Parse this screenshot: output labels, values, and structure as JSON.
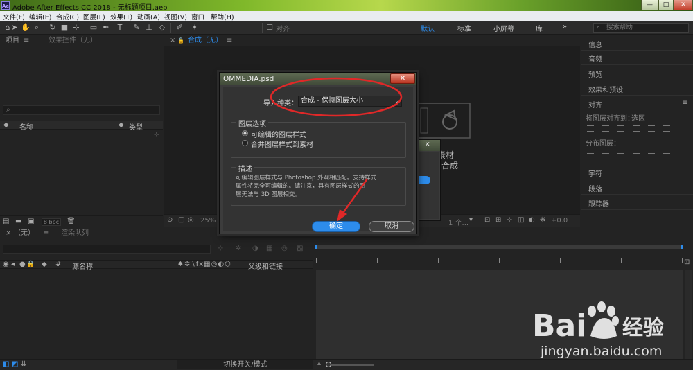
{
  "window": {
    "app_icon": "Ae",
    "title": "Adobe After Effects CC 2018 - 无标题项目.aep",
    "min_label": "—",
    "max_label": "□",
    "close_label": "✕"
  },
  "menu": [
    "文件(F)",
    "编辑(E)",
    "合成(C)",
    "图层(L)",
    "效果(T)",
    "动画(A)",
    "视图(V)",
    "窗口",
    "帮助(H)"
  ],
  "toolbar": {
    "align_label": "对齐",
    "workspaces": [
      "默认",
      "标准",
      "小屏幕",
      "库"
    ],
    "more": "»",
    "search_placeholder": "搜索帮助"
  },
  "project_panel": {
    "tab1": "项目",
    "tab1_menu": "≡",
    "tab2": "效果控件（无）",
    "search_icon": "⌕",
    "col_name": "名称",
    "col_type": "类型",
    "bpc": "8 bpc"
  },
  "comp_panel": {
    "close": "×",
    "lock": "🔒",
    "tab": "合成（无）",
    "tab_menu": "≡",
    "bg_text1": "素材",
    "bg_text2": "合成",
    "zoom": "25%",
    "view_label": "1 个...",
    "offset": "+0.0"
  },
  "right_panel": {
    "items": [
      "信息",
      "音频",
      "预览",
      "效果和预设"
    ],
    "align_title": "对齐",
    "align_title_menu": "≡",
    "align_to_label": "将图层对齐到：",
    "align_to_value": "选区",
    "distribute_label": "分布图层：",
    "items2": [
      "字符",
      "段落",
      "跟踪器"
    ]
  },
  "timeline": {
    "close": "×",
    "tab1": "（无）",
    "tab1_menu": "≡",
    "tab2": "渲染队列",
    "col_hash": "#",
    "col_source": "源名称",
    "col_parent": "父级和链接",
    "footer_label": "切换开关/模式"
  },
  "behind_dialog": {
    "close": "✕"
  },
  "dialog": {
    "title": "OMMEDIA.psd",
    "close": "✕",
    "import_type_label": "导入种类：",
    "import_type_value": "合成 - 保持图层大小",
    "layer_options_title": "图层选项",
    "option1": "可编辑的图层样式",
    "option2": "合并图层样式到素材",
    "description_title": "描述",
    "description_lines": [
      "可编辑图层样式与 Photoshop 外观相匹配。支持样式",
      "属性将完全可编辑的。请注意，具有图层样式的图",
      "层无法与 3D 图层相交。"
    ],
    "ok": "确定",
    "cancel": "取消"
  },
  "watermark": {
    "brand_left": "Bai",
    "brand_right": "经验",
    "url": "jingyan.baidu.com"
  },
  "colors": {
    "accent": "#2d8ceb",
    "annotation": "#e02828",
    "panel_bg": "#232323"
  }
}
